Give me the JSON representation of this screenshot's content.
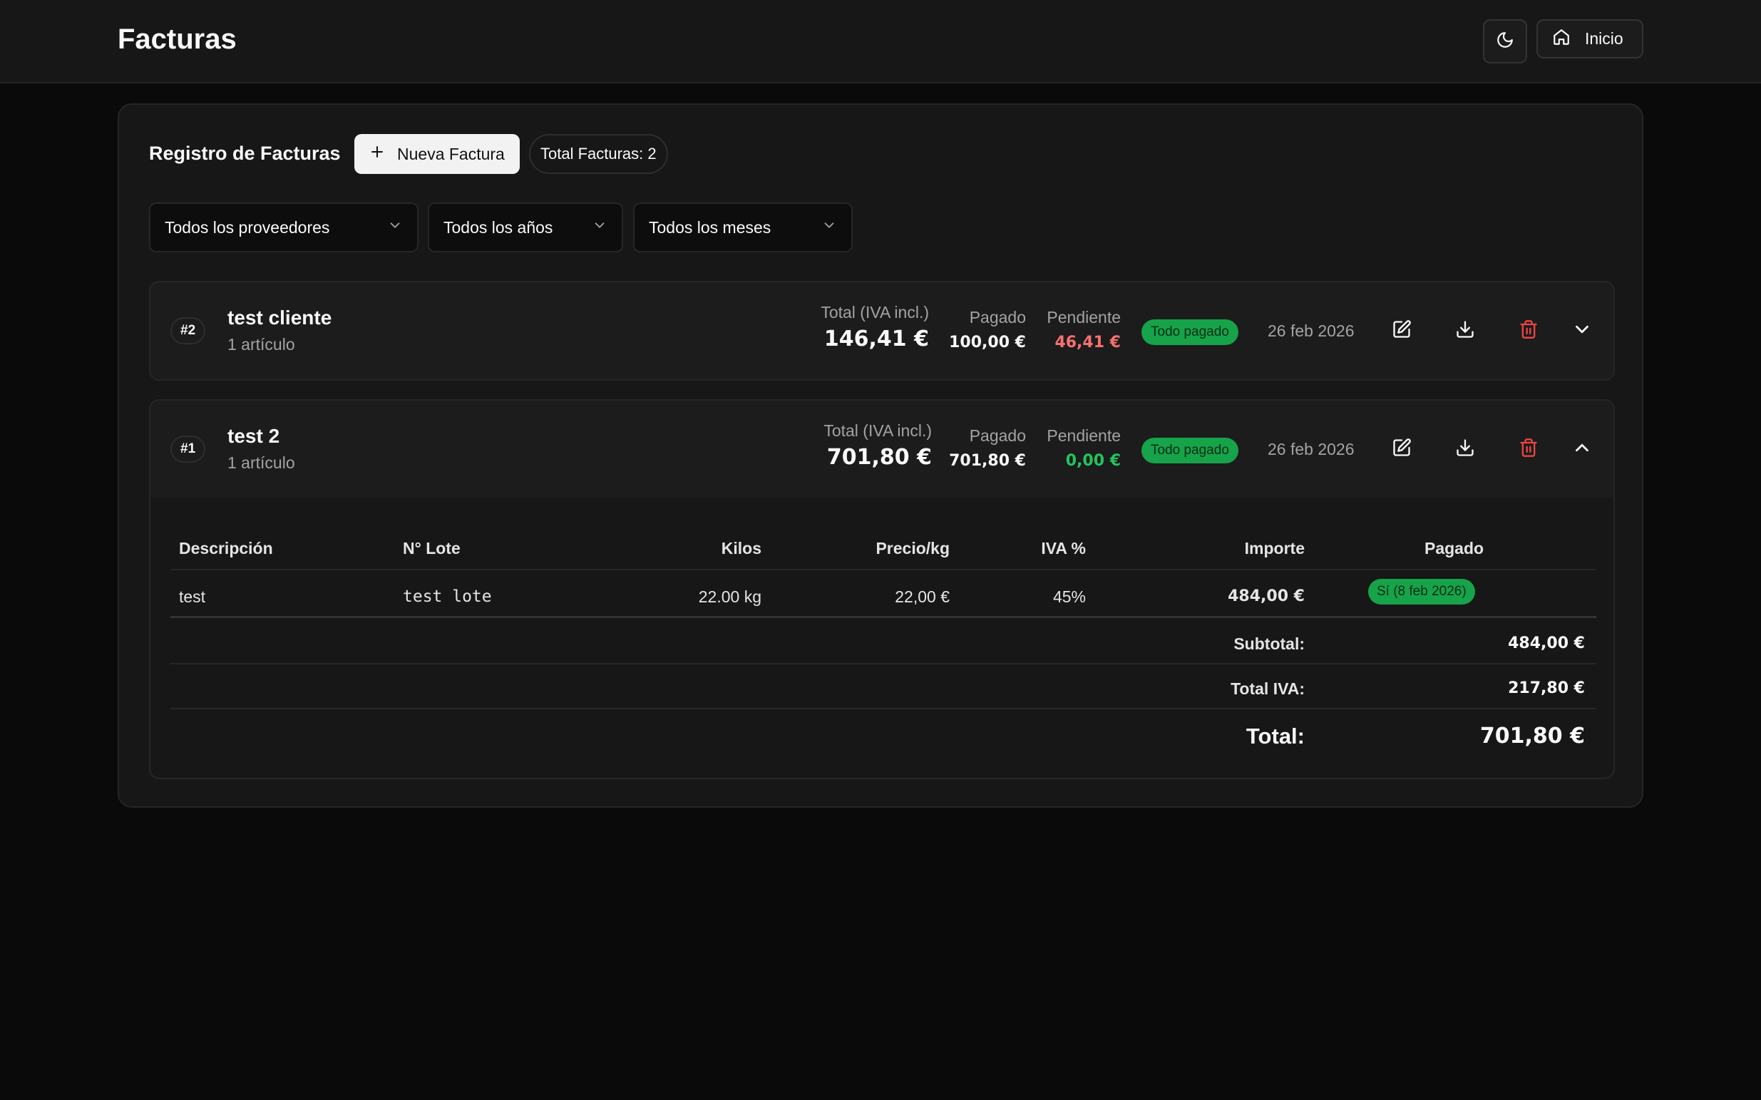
{
  "header": {
    "title": "Facturas",
    "home_label": "Inicio"
  },
  "registry": {
    "title": "Registro de Facturas",
    "new_button": "Nueva Factura",
    "total_badge": "Total Facturas: 2"
  },
  "filters": {
    "provider": "Todos los proveedores",
    "year": "Todos los años",
    "month": "Todos los meses"
  },
  "labels": {
    "total": "Total (IVA incl.)",
    "paid": "Pagado",
    "pending": "Pendiente"
  },
  "invoices": [
    {
      "number": "#2",
      "client": "test cliente",
      "items": "1 artículo",
      "total": "146,41 €",
      "paid": "100,00 €",
      "pending": "46,41 €",
      "status": "Todo pagado",
      "date": "26 feb 2026"
    },
    {
      "number": "#1",
      "client": "test 2",
      "items": "1 artículo",
      "total": "701,80 €",
      "paid": "701,80 €",
      "pending": "0,00 €",
      "status": "Todo pagado",
      "date": "26 feb 2026",
      "detail": {
        "headers": [
          "Descripción",
          "N° Lote",
          "Kilos",
          "Precio/kg",
          "IVA %",
          "Importe",
          "Pagado"
        ],
        "rows": [
          {
            "description": "test",
            "lot": "test lote",
            "kilos": "22.00 kg",
            "price": "22,00 €",
            "vat": "45%",
            "amount": "484,00 €",
            "paid": "Sí (8 feb 2026)"
          }
        ],
        "subtotal_label": "Subtotal:",
        "subtotal": "484,00 €",
        "vat_label": "Total IVA:",
        "vat_total": "217,80 €",
        "total_label": "Total:",
        "total": "701,80 €"
      }
    }
  ],
  "colors": {
    "pending_red": "#f87171",
    "pending_green": "#22c55e",
    "status_green": "#16a34a",
    "delete_red": "#ef4444"
  }
}
